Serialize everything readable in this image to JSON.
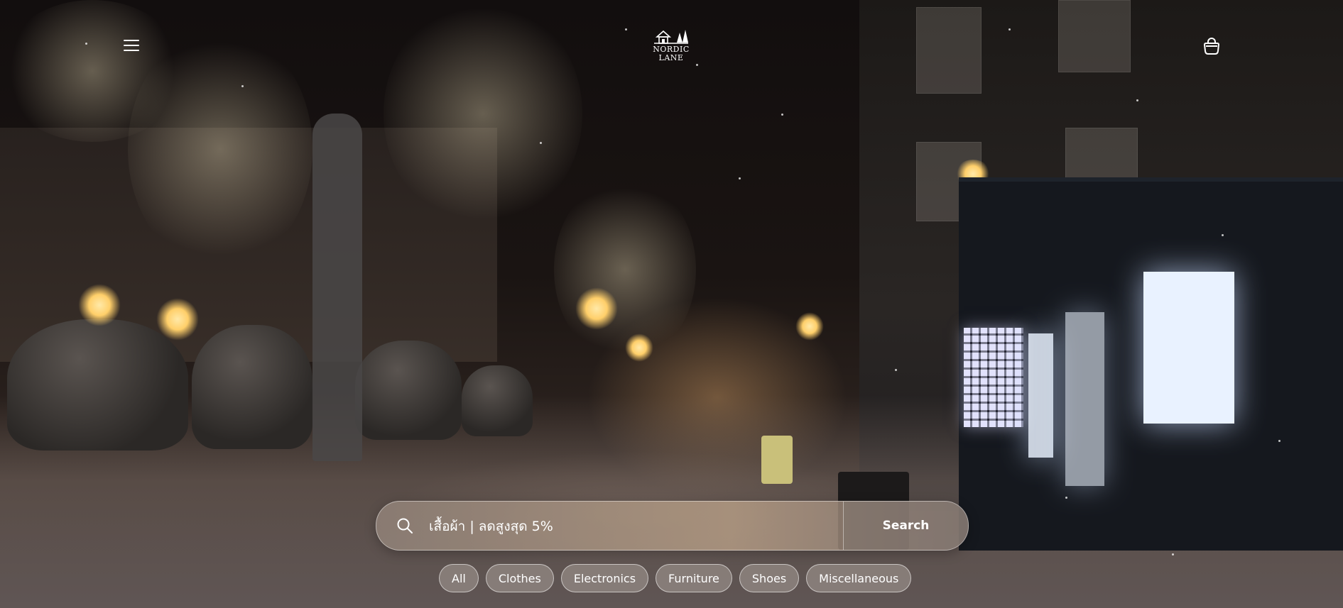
{
  "brand": {
    "name_line1": "NORDIC",
    "name_line2": "LANE",
    "logo_icon": "cabin-and-pine-trees-icon"
  },
  "header": {
    "menu_icon": "hamburger-menu-icon",
    "cart_icon": "shopping-bag-icon"
  },
  "search": {
    "placeholder": "เสื้อผ้า | ลดสูงสุด 5%",
    "value": "",
    "button_label": "Search",
    "icon": "search-icon"
  },
  "categories": [
    {
      "label": "All"
    },
    {
      "label": "Clothes"
    },
    {
      "label": "Electronics"
    },
    {
      "label": "Furniture"
    },
    {
      "label": "Shoes"
    },
    {
      "label": "Miscellaneous"
    }
  ],
  "colors": {
    "text": "#ffffff",
    "background": "#120e0e"
  }
}
